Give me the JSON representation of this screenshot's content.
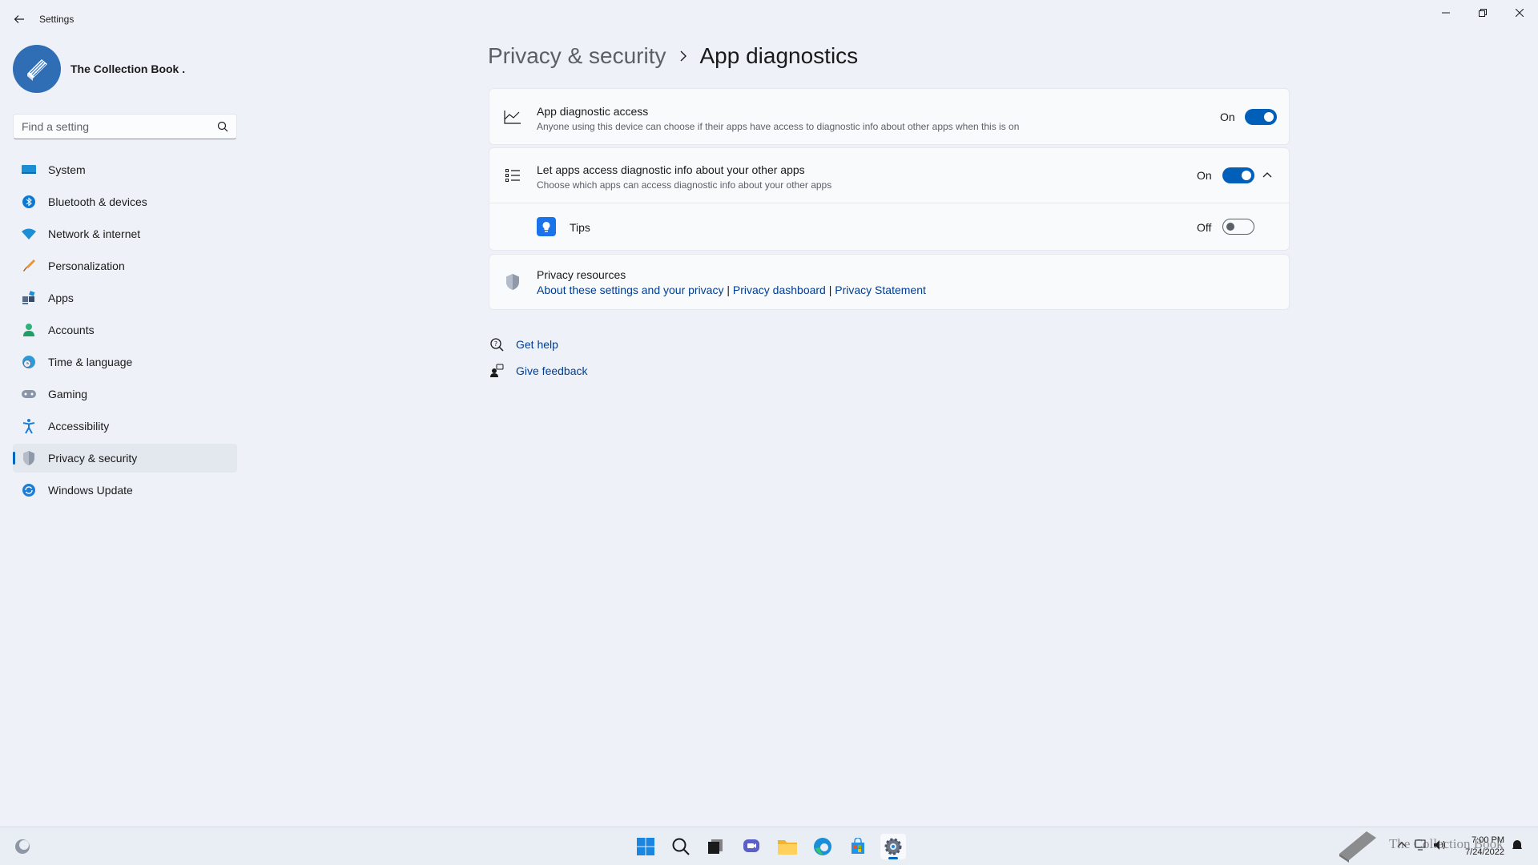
{
  "window": {
    "title": "Settings",
    "controls": [
      "minimize",
      "restore",
      "close"
    ]
  },
  "profile": {
    "name": "The Collection Book ."
  },
  "search": {
    "placeholder": "Find a setting"
  },
  "sidebar": {
    "items": [
      {
        "label": "System",
        "icon": "monitor-icon"
      },
      {
        "label": "Bluetooth & devices",
        "icon": "bluetooth-icon"
      },
      {
        "label": "Network & internet",
        "icon": "wifi-icon"
      },
      {
        "label": "Personalization",
        "icon": "brush-icon"
      },
      {
        "label": "Apps",
        "icon": "apps-icon"
      },
      {
        "label": "Accounts",
        "icon": "person-icon"
      },
      {
        "label": "Time & language",
        "icon": "globe-clock-icon"
      },
      {
        "label": "Gaming",
        "icon": "gamepad-icon"
      },
      {
        "label": "Accessibility",
        "icon": "accessibility-icon"
      },
      {
        "label": "Privacy & security",
        "icon": "shield-icon",
        "active": true
      },
      {
        "label": "Windows Update",
        "icon": "update-icon"
      }
    ]
  },
  "breadcrumb": {
    "parent": "Privacy & security",
    "current": "App diagnostics"
  },
  "settings": {
    "app_diagnostic": {
      "title": "App diagnostic access",
      "desc": "Anyone using this device can choose if their apps have access to diagnostic info about other apps when this is on",
      "state": "On"
    },
    "let_apps": {
      "title": "Let apps access diagnostic info about your other apps",
      "desc": "Choose which apps can access diagnostic info about your other apps",
      "state": "On"
    },
    "tips": {
      "title": "Tips",
      "state": "Off"
    },
    "privacy_resources": {
      "title": "Privacy resources",
      "link1": "About these settings and your privacy",
      "link2": "Privacy dashboard",
      "link3": "Privacy Statement",
      "sep": "|"
    }
  },
  "help": {
    "get_help": "Get help",
    "give_feedback": "Give feedback"
  },
  "taskbar": {
    "time": "7:00 PM",
    "date": "7/24/2022",
    "watermark": "The Collection Book"
  },
  "colors": {
    "accent": "#005fb8",
    "link": "#003e92",
    "background": "#eef2f8"
  }
}
